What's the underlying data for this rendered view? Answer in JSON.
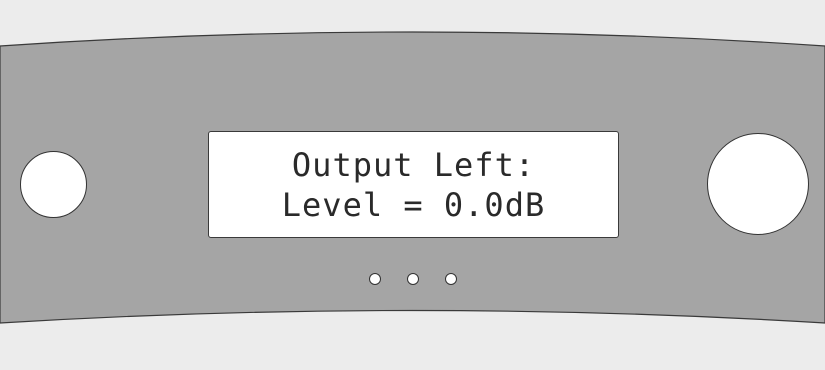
{
  "display": {
    "line1": "Output Left:",
    "line2": "Level = 0.0dB"
  },
  "controls": {
    "left_button": "button",
    "right_knob": "rotary-knob",
    "indicator_count": 3
  },
  "colors": {
    "background": "#ececec",
    "panel": "#a5a5a5",
    "display_background": "#ffffff",
    "display_text": "#2a2a2a",
    "outline": "#333333"
  }
}
